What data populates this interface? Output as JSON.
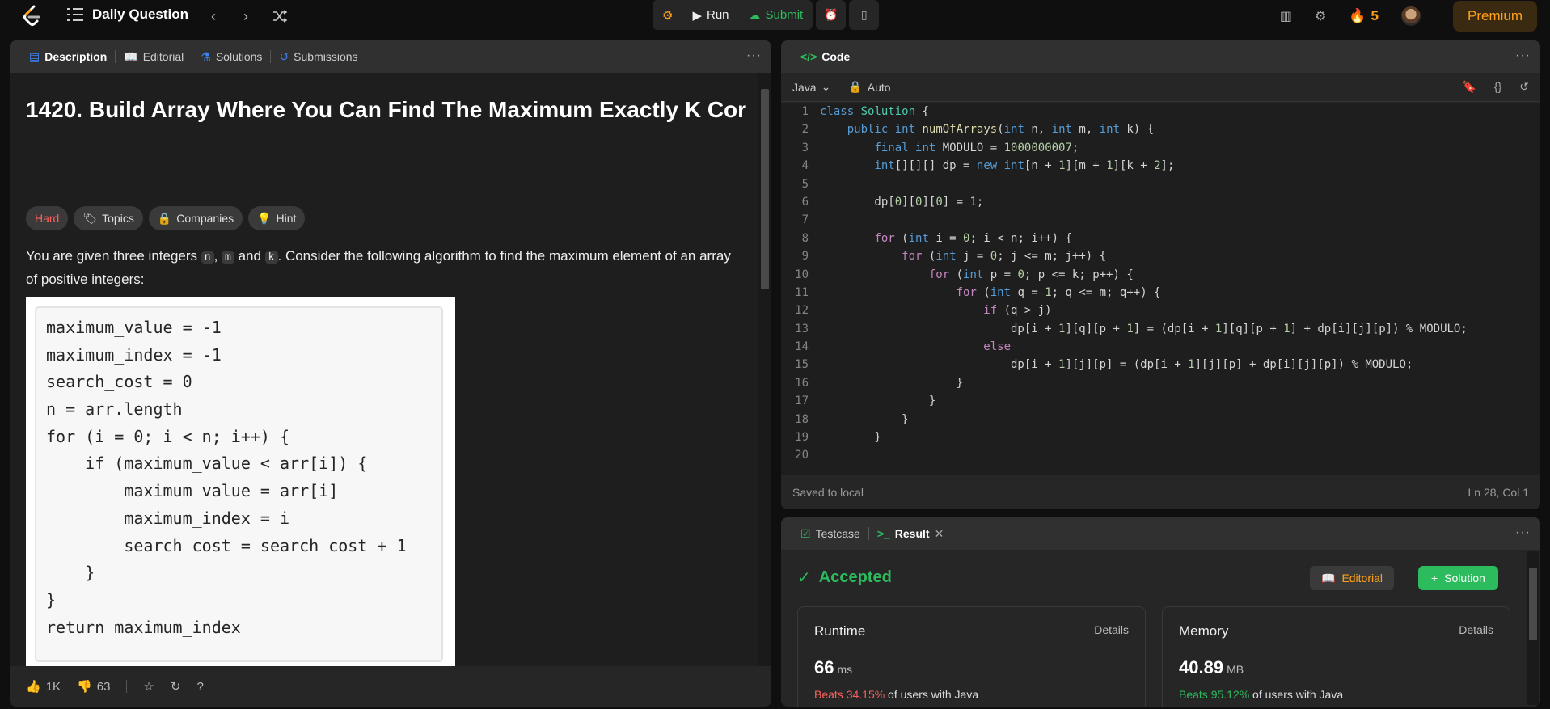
{
  "topbar": {
    "title": "Daily Question",
    "run": "Run",
    "submit": "Submit",
    "streak": "5",
    "premium": "Premium"
  },
  "left": {
    "tabs": [
      "Description",
      "Editorial",
      "Solutions",
      "Submissions"
    ],
    "title": "1420. Build Array Where You Can Find The Maximum Exactly K Cor",
    "chips": [
      "Hard",
      "Topics",
      "Companies",
      "Hint"
    ],
    "para": {
      "p1": "You are given three integers ",
      "c1": "n",
      "p2": ", ",
      "c2": "m",
      "p3": " and ",
      "c3": "k",
      "p4": ". Consider the following algorithm to find the maximum element of an array of positive integers:"
    },
    "algo": [
      "maximum_value = -1",
      "maximum_index = -1",
      "search_cost = 0",
      "n = arr.length",
      "for (i = 0; i < n; i++) {",
      "    if (maximum_value < arr[i]) {",
      "        maximum_value = arr[i]",
      "        maximum_index = i",
      "        search_cost = search_cost + 1",
      "    }",
      "}",
      "return maximum_index"
    ],
    "likes": "1K",
    "dislikes": "63"
  },
  "code": {
    "header": "Code",
    "language": "Java",
    "mode": "Auto",
    "saved": "Saved to local",
    "position": "Ln 28, Col 1",
    "lines": [
      "class Solution {",
      "    public int numOfArrays(int n, int m, int k) {",
      "        final int MODULO = 1000000007;",
      "        int[][][] dp = new int[n + 1][m + 1][k + 2];",
      "",
      "        dp[0][0][0] = 1;",
      "",
      "        for (int i = 0; i < n; i++) {",
      "            for (int j = 0; j <= m; j++) {",
      "                for (int p = 0; p <= k; p++) {",
      "                    for (int q = 1; q <= m; q++) {",
      "                        if (q > j)",
      "                            dp[i + 1][q][p + 1] = (dp[i + 1][q][p + 1] + dp[i][j][p]) % MODULO;",
      "                        else",
      "                            dp[i + 1][j][p] = (dp[i + 1][j][p] + dp[i][j][p]) % MODULO;",
      "                    }",
      "                }",
      "            }",
      "        }",
      ""
    ]
  },
  "result": {
    "tabs": [
      "Testcase",
      "Result"
    ],
    "status": "Accepted",
    "editorial": "Editorial",
    "solution": "Solution",
    "runtime": {
      "label": "Runtime",
      "details": "Details",
      "value": "66",
      "unit": "ms",
      "beats": "Beats 34.15%",
      "suffix": " of users with Java"
    },
    "memory": {
      "label": "Memory",
      "details": "Details",
      "value": "40.89",
      "unit": "MB",
      "beats": "Beats 95.12%",
      "suffix": " of users with Java"
    }
  },
  "colors": {
    "accent": "#ffa116",
    "green": "#2cbb5d",
    "red": "#f8615c"
  }
}
